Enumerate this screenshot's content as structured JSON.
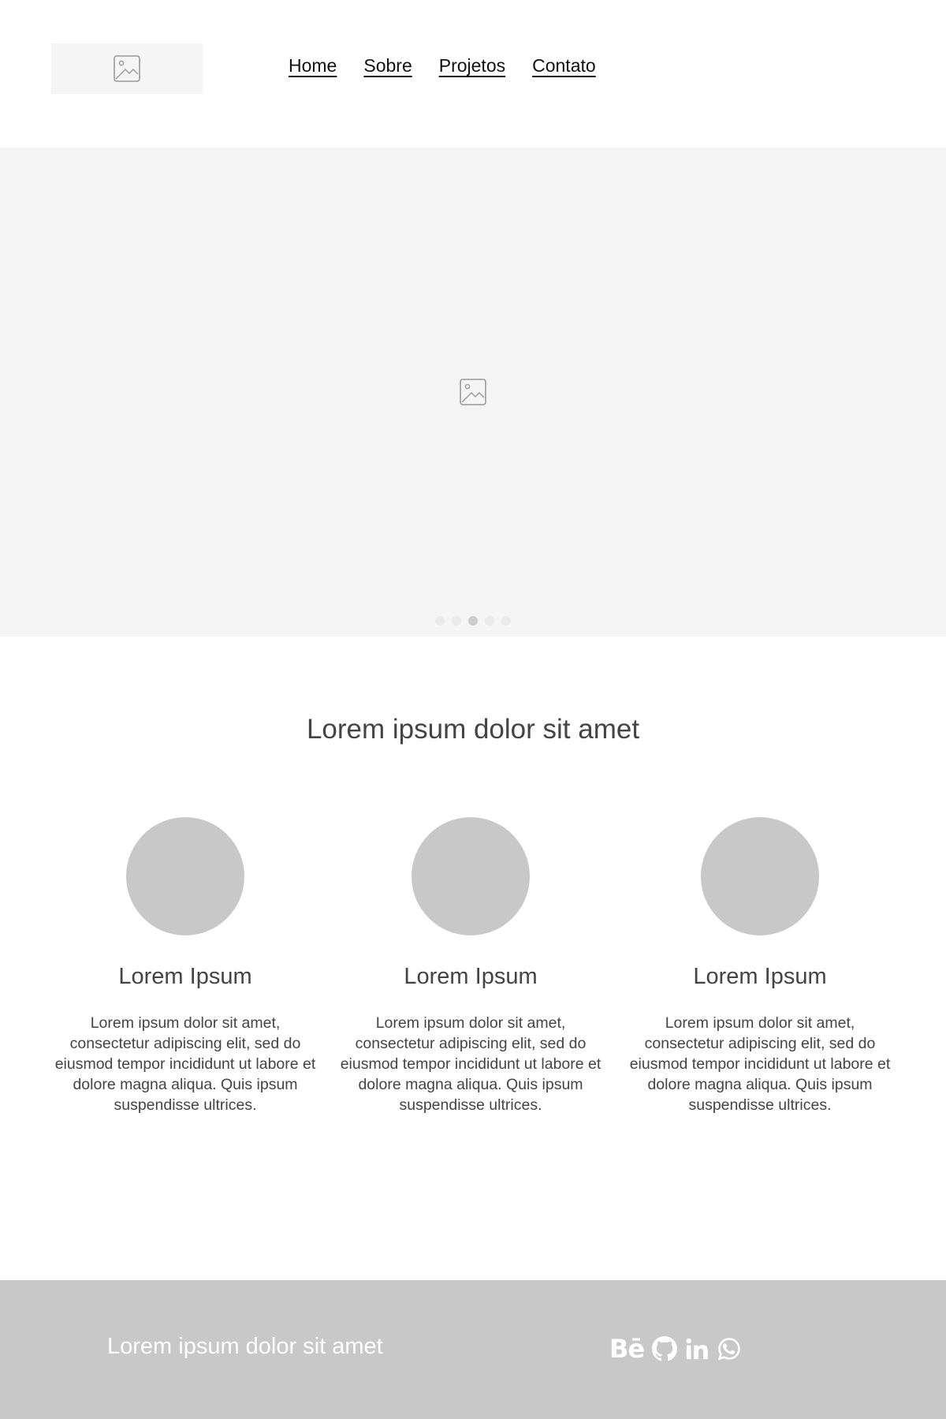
{
  "header": {
    "nav": [
      {
        "label": "Home"
      },
      {
        "label": "Sobre"
      },
      {
        "label": "Projetos"
      },
      {
        "label": "Contato"
      }
    ]
  },
  "hero": {
    "icon": "image-placeholder-icon",
    "slides_total": 5,
    "active_slide": 3
  },
  "features": {
    "title": "Lorem ipsum dolor sit amet",
    "items": [
      {
        "title": "Lorem Ipsum",
        "text": "Lorem ipsum dolor sit amet, consectetur adipiscing elit, sed do eiusmod tempor incididunt ut labore et dolore magna aliqua. Quis ipsum suspendisse ultrices."
      },
      {
        "title": "Lorem Ipsum",
        "text": "Lorem ipsum dolor sit amet, consectetur adipiscing elit, sed do eiusmod tempor incididunt ut labore et dolore magna aliqua. Quis ipsum suspendisse ultrices."
      },
      {
        "title": "Lorem Ipsum",
        "text": "Lorem ipsum dolor sit amet, consectetur adipiscing elit, sed do eiusmod tempor incididunt ut labore et dolore magna aliqua. Quis ipsum suspendisse ultrices."
      }
    ]
  },
  "footer": {
    "text": "Lorem ipsum dolor sit amet",
    "social": [
      {
        "icon": "behance-icon",
        "glyph": "Bē"
      },
      {
        "icon": "github-icon"
      },
      {
        "icon": "linkedin-icon"
      },
      {
        "icon": "whatsapp-icon"
      }
    ]
  },
  "colors": {
    "placeholder_bg": "#f5f5f5",
    "circle": "#c8c8c8",
    "footer_bg": "#c8c8c8",
    "text": "#444444",
    "nav_text": "#111111"
  }
}
